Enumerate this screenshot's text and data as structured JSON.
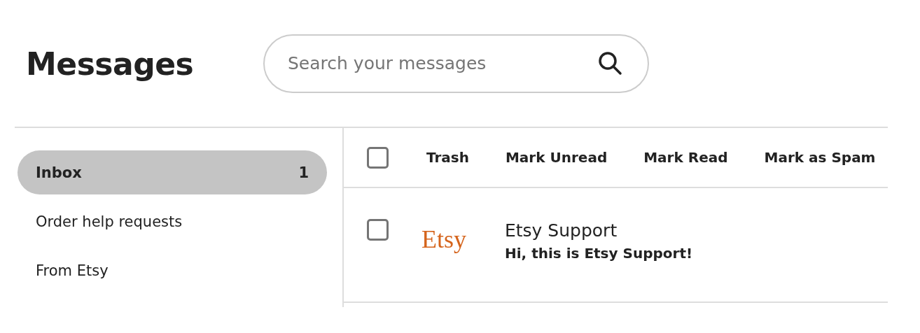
{
  "title": "Messages",
  "search": {
    "placeholder": "Search your messages"
  },
  "sidebar": {
    "items": [
      {
        "label": "Inbox",
        "count": "1",
        "selected": true
      },
      {
        "label": "Order help requests",
        "selected": false
      },
      {
        "label": "From Etsy",
        "selected": false
      }
    ]
  },
  "toolbar": {
    "select_all": {
      "checked": false
    },
    "actions": [
      "Trash",
      "Mark Unread",
      "Mark Read",
      "Mark as Spam"
    ]
  },
  "messages": [
    {
      "checked": false,
      "logo": "Etsy",
      "sender": "Etsy Support",
      "preview": "Hi, this is Etsy Support!",
      "unread": true
    }
  ]
}
